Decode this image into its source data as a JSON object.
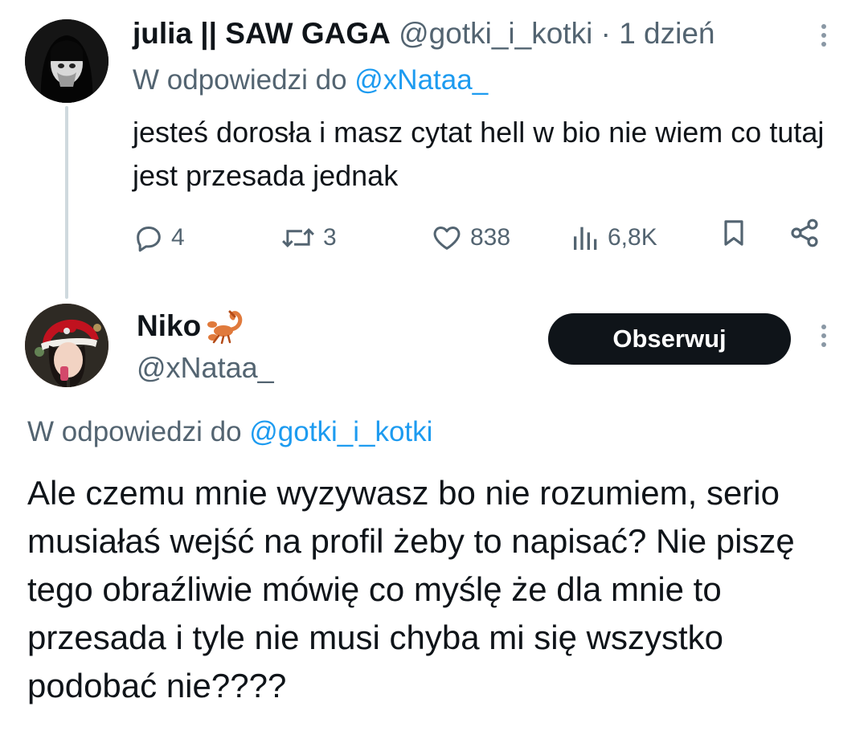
{
  "tweet1": {
    "display_name": "julia || SAW GAGA",
    "handle": "@gotki_i_kotki",
    "separator": "·",
    "time": "1 dzień",
    "reply_prefix": "W odpowiedzi do",
    "reply_to": "@xNataa_",
    "text": "jesteś dorosła i masz cytat hell w bio nie wiem co tutaj jest przesada jednak",
    "actions": {
      "replies": "4",
      "retweets": "3",
      "likes": "838",
      "views": "6,8K"
    },
    "icons": [
      "reply-icon",
      "retweet-icon",
      "heart-icon",
      "views-icon",
      "bookmark-icon",
      "share-icon",
      "more-icon"
    ]
  },
  "tweet2": {
    "display_name": "Niko",
    "name_emoji": "🦂",
    "handle": "@xNataa_",
    "follow_label": "Obserwuj",
    "reply_prefix": "W odpowiedzi do",
    "reply_to": "@gotki_i_kotki",
    "text": "Ale czemu mnie wyzywasz bo nie rozumiem, serio musiałaś wejść na profil żeby to napisać? Nie piszę tego obraźliwie mówię co myślę że dla mnie to przesada i tyle nie musi chyba mi się wszystko podobać nie????"
  },
  "colors": {
    "text": "#0f1419",
    "muted": "#536471",
    "link": "#1d9bf0",
    "thread_line": "#cfd9de",
    "follow_bg": "#0f1419"
  }
}
